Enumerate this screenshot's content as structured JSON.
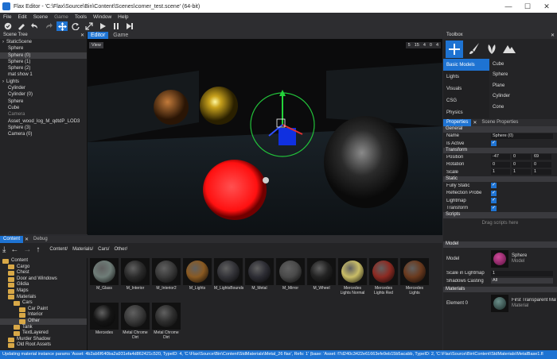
{
  "title": "Flax Editor - 'C:\\Flax\\Source\\Bin\\Content\\Scenes\\corner_test.scene' (64-bit)",
  "window_controls": [
    "—",
    "☐",
    "✕"
  ],
  "menu": [
    "File",
    "Edit",
    "Scene",
    "Game",
    "Tools",
    "Window",
    "Help"
  ],
  "scene_tree": {
    "tab": "Scene Tree",
    "items": [
      {
        "label": "StaticScene",
        "indent": 0,
        "arrow": "›"
      },
      {
        "label": "Sphere",
        "indent": 1
      },
      {
        "label": "Sphere (0)",
        "indent": 1,
        "sel": true
      },
      {
        "label": "Sphere (1)",
        "indent": 1
      },
      {
        "label": "Sphere (2)",
        "indent": 1
      },
      {
        "label": "mat show 1",
        "indent": 1
      },
      {
        "label": "Lights",
        "indent": 0,
        "arrow": "›"
      },
      {
        "label": "Cylinder",
        "indent": 1
      },
      {
        "label": "Cylinder (0)",
        "indent": 1
      },
      {
        "label": "Sphere",
        "indent": 1
      },
      {
        "label": "Cube",
        "indent": 1
      },
      {
        "label": "Camera",
        "indent": 1,
        "dim": true
      },
      {
        "label": "Asset_wood_log_M_qdtdP_LOD3",
        "indent": 1
      },
      {
        "label": "Sphere (3)",
        "indent": 1
      },
      {
        "label": "Camera (0)",
        "indent": 1
      }
    ]
  },
  "editor": {
    "tabs": [
      "Editor",
      "Game"
    ],
    "view_button": "View",
    "overlay": {
      "a": "5",
      "b": "15",
      "c": "4",
      "d": "0",
      "e": "4"
    }
  },
  "toolbox": {
    "tab": "Toolbox",
    "categories": [
      "Basic Models",
      "Lights",
      "Visuals",
      "CSG",
      "Physics"
    ],
    "items": [
      "Cube",
      "Sphere",
      "Plane",
      "Cylinder",
      "Cone"
    ]
  },
  "properties": {
    "tabs": [
      "Properties",
      "Scene Properties"
    ],
    "general": "General",
    "name_label": "Name",
    "name_value": "Sphere (0)",
    "active_label": "Is Active",
    "transform": "Transform",
    "position_label": "Position",
    "position": [
      "-47",
      "0",
      "69"
    ],
    "rotation_label": "Rotation",
    "rotation": [
      "0",
      "0",
      "0"
    ],
    "scale_label": "Scale",
    "scale": [
      "1",
      "1",
      "1"
    ],
    "static": "Static",
    "flags": [
      "Fully Static",
      "Reflection Probe",
      "Lightmap",
      "Transform"
    ],
    "scripts": "Scripts",
    "drag_scripts": "Drag scripts here"
  },
  "model_panel": {
    "model_section": "Model",
    "model_label": "Model",
    "model_name": "Sphere",
    "model_type": "Model",
    "scale_lightmap_label": "Scale in Lightmap",
    "scale_lightmap": "1",
    "shadows_label": "Shadows Casting",
    "shadows_value": "All",
    "materials_section": "Materials",
    "element_label": "Element 0",
    "material_name": "First Transparent Mate",
    "material_type": "Material"
  },
  "content": {
    "tabs": [
      "Content",
      "Debug"
    ],
    "breadcrumb": [
      "Content/",
      "Materials/",
      "Cars/",
      "Other/"
    ],
    "folders": [
      {
        "label": "Content",
        "depth": 0
      },
      {
        "label": "Cargo",
        "depth": 1
      },
      {
        "label": "Chest",
        "depth": 1
      },
      {
        "label": "Door and Windows",
        "depth": 1
      },
      {
        "label": "Glidia",
        "depth": 1
      },
      {
        "label": "Maps",
        "depth": 1
      },
      {
        "label": "Materials",
        "depth": 1
      },
      {
        "label": "Cars",
        "depth": 2
      },
      {
        "label": "Car Paint",
        "depth": 3
      },
      {
        "label": "Interior",
        "depth": 3
      },
      {
        "label": "Other",
        "depth": 3,
        "sel": true
      },
      {
        "label": "Tank",
        "depth": 2
      },
      {
        "label": "TextLayered",
        "depth": 2
      },
      {
        "label": "Murder Shadow",
        "depth": 1
      },
      {
        "label": "Old Root Assets",
        "depth": 1
      }
    ],
    "assets": [
      {
        "label": "M_Glass",
        "color": "#6f7d78"
      },
      {
        "label": "M_Interior",
        "color": "#2b2b2b"
      },
      {
        "label": "M_Interior2",
        "color": "#3a3a3a"
      },
      {
        "label": "M_Lights",
        "color": "#8a5a22"
      },
      {
        "label": "M_LightsBounds",
        "color": "#333338"
      },
      {
        "label": "M_Metal",
        "color": "#2d2d34"
      },
      {
        "label": "M_Mirror",
        "color": "#4a4a4a"
      },
      {
        "label": "M_Wheel",
        "color": "#232323"
      },
      {
        "label": "Mercedes Lights Normal",
        "color": "#c9bd67"
      },
      {
        "label": "Mercedes Lights Red",
        "color": "#8c2a22"
      },
      {
        "label": "Mercedes Lights",
        "color": "#6a3a1e"
      },
      {
        "label": "Mercedes",
        "color": "#151515"
      },
      {
        "label": "Metal Chrome Dirt",
        "color": "#3a3a3a"
      },
      {
        "label": "Metal Chrome Dirt",
        "color": "#2f2f2f"
      }
    ]
  },
  "status": "Updating material instance params 'Asset: 4b2ab6f640ba2a931efa4d862421c520, TypeID: 4, 'C:\\Flax\\Source\\Bin\\Content\\StdMaterials\\Metal_26 flax', Refs: 1' (base: 'Asset: f7d240c3422e61663efe9eb15b5acabb, TypeID: 2, 'C:\\Flax\\Source\\Bin\\Content\\StdMaterials\\MetalBase1.fl"
}
